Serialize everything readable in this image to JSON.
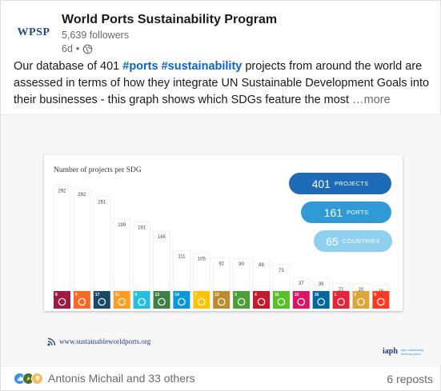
{
  "post": {
    "author": {
      "name": "World Ports Sustainability Program",
      "logo_text": "WPSP",
      "followers": "5,639 followers",
      "time": "6d",
      "separator": "•",
      "visibility_icon": "globe-icon"
    },
    "text": {
      "part1": "Our database of 401 ",
      "hashtag1": "#ports",
      "space": " ",
      "hashtag2": "#sustainability",
      "part2": " projects from around the world are assessed in terms of how they integrate UN Sustainable Development Goals into their businesses - this graph shows which SDGs feature the most ",
      "more": "…more"
    },
    "image": {
      "site": "www.sustainableworldports.org",
      "partner_logo": "iaph",
      "partner_tagline": "iaph celebrating seventy years",
      "stats": [
        {
          "value": "401",
          "label": "PROJECTS",
          "color": "#1d6bb6"
        },
        {
          "value": "161",
          "label": "PORTS",
          "color": "#2f9ad6"
        },
        {
          "value": "65",
          "label": "COUNTRIES",
          "color": "#8fd0ee"
        }
      ]
    },
    "footer": {
      "reaction_icons": [
        "like-icon",
        "celebrate-icon",
        "insightful-icon"
      ],
      "reactors": "Antonis Michail and 33 others",
      "reposts": "6 reposts"
    }
  },
  "chart_data": {
    "type": "bar",
    "title": "Number of projects per SDG",
    "categories": [
      "8",
      "9",
      "17",
      "11",
      "6",
      "13",
      "14",
      "7",
      "12",
      "3",
      "4",
      "15",
      "10",
      "16",
      "1",
      "2",
      "5"
    ],
    "values": [
      292,
      282,
      261,
      199,
      191,
      165,
      111,
      105,
      92,
      90,
      88,
      73,
      37,
      35,
      21,
      20,
      15
    ],
    "colors": [
      "#a21942",
      "#fd6925",
      "#19486a",
      "#fd9d24",
      "#26bde2",
      "#3f7e44",
      "#0a97d9",
      "#fcc30b",
      "#bf8b2e",
      "#4c9f38",
      "#c5192d",
      "#56c02b",
      "#dd1367",
      "#00689d",
      "#e5243b",
      "#dda63a",
      "#ff3a21"
    ],
    "ylim": [
      0,
      300
    ]
  }
}
